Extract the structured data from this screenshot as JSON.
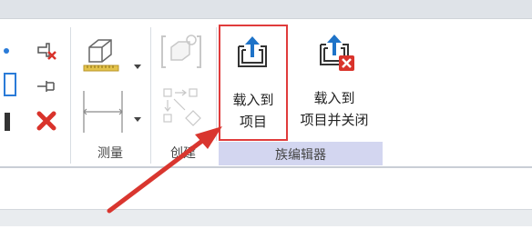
{
  "ribbon": {
    "groups": {
      "measure": "测量",
      "create": "创建",
      "family_editor": "族编辑器"
    },
    "buttons": {
      "load_into_project": {
        "line1": "载入到",
        "line2": "项目"
      },
      "load_into_project_and_close": {
        "line1": "载入到",
        "line2": "项目并关闭"
      }
    }
  },
  "colors": {
    "highlight": "#e03c3c",
    "arrow": "#d9362f",
    "family_group_band": "#d3d6f0",
    "close_badge": "#d9332b"
  },
  "icons": [
    "pin-delete-icon",
    "pin-icon",
    "delete-x-icon",
    "3d-box-icon",
    "ruler-icon",
    "aligned-dimension-icon",
    "create-similar-icon",
    "create-group-icon",
    "load-into-project-icon",
    "load-into-project-and-close-icon",
    "annotation-arrow"
  ]
}
